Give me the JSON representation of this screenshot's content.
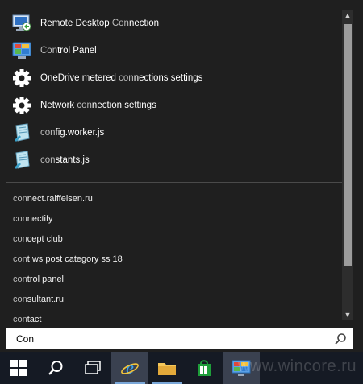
{
  "apps": [
    {
      "name_a": "Remote Desktop ",
      "name_b": "Con",
      "name_c": "nection",
      "icon": "remote-desktop-icon"
    },
    {
      "name_a": "",
      "name_b": "Con",
      "name_c": "trol Panel",
      "icon": "control-panel-icon"
    },
    {
      "name_a": "OneDrive metered ",
      "name_b": "con",
      "name_c": "nections settings",
      "icon": "gear-icon"
    },
    {
      "name_a": "Network ",
      "name_b": "con",
      "name_c": "nection settings",
      "icon": "gear-icon"
    },
    {
      "name_a": "",
      "name_b": "con",
      "name_c": "fig.worker.js",
      "icon": "js-file-icon"
    },
    {
      "name_a": "",
      "name_b": "con",
      "name_c": "stants.js",
      "icon": "js-file-icon"
    }
  ],
  "suggestions": [
    {
      "a": "con",
      "b": "nect.raiffeisen.ru"
    },
    {
      "a": "con",
      "b": "nectify"
    },
    {
      "a": "con",
      "b": "cept club"
    },
    {
      "a": "con",
      "b": "t ws post category ss 18"
    },
    {
      "a": "con",
      "b": "trol panel"
    },
    {
      "a": "con",
      "b": "sultant.ru"
    },
    {
      "a": "con",
      "b": "tact"
    }
  ],
  "search": {
    "value": "Con"
  },
  "taskbar": {
    "items": [
      "start-icon",
      "search-icon",
      "task-view-icon",
      "internet-explorer-icon",
      "file-explorer-icon",
      "store-icon",
      "control-panel-icon"
    ]
  },
  "watermark": "www.wincore.ru",
  "colors": {
    "accent": "#7aa7d8",
    "panel": "#1f1f1f",
    "taskbar": "#151a24"
  }
}
